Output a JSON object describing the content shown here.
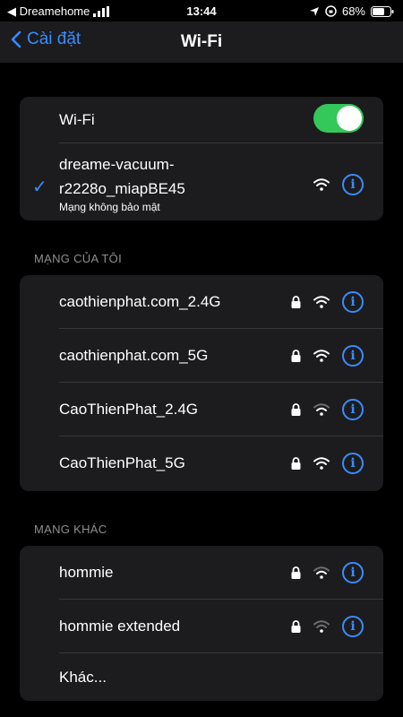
{
  "status_bar": {
    "back_app": "◀ Dreamehome",
    "time": "13:44",
    "battery": "68%"
  },
  "nav": {
    "back_label": "Cài đặt",
    "title": "Wi-Fi"
  },
  "wifi": {
    "label": "Wi-Fi",
    "enabled": true,
    "connected": {
      "name": "dreame-vacuum-r2228o_miapBE45",
      "name_line1": "dreame-vacuum-",
      "name_line2": "r2228o_miapBE45",
      "subtitle": "Mạng không bảo mật"
    }
  },
  "my_networks": {
    "header": "MẠNG CỦA TÔI",
    "items": [
      {
        "name": "caothienphat.com_2.4G",
        "secured": true
      },
      {
        "name": "caothienphat.com_5G",
        "secured": true
      },
      {
        "name": "CaoThienPhat_2.4G",
        "secured": true
      },
      {
        "name": "CaoThienPhat_5G",
        "secured": true
      }
    ]
  },
  "other_networks": {
    "header": "MẠNG KHÁC",
    "items": [
      {
        "name": "hommie",
        "secured": true
      },
      {
        "name": "hommie extended",
        "secured": true
      }
    ],
    "other_label": "Khác..."
  },
  "colors": {
    "accent": "#3a8cff",
    "toggle_on": "#34c759",
    "cell_bg": "#1c1c1e",
    "header_text": "#8e8e93"
  }
}
